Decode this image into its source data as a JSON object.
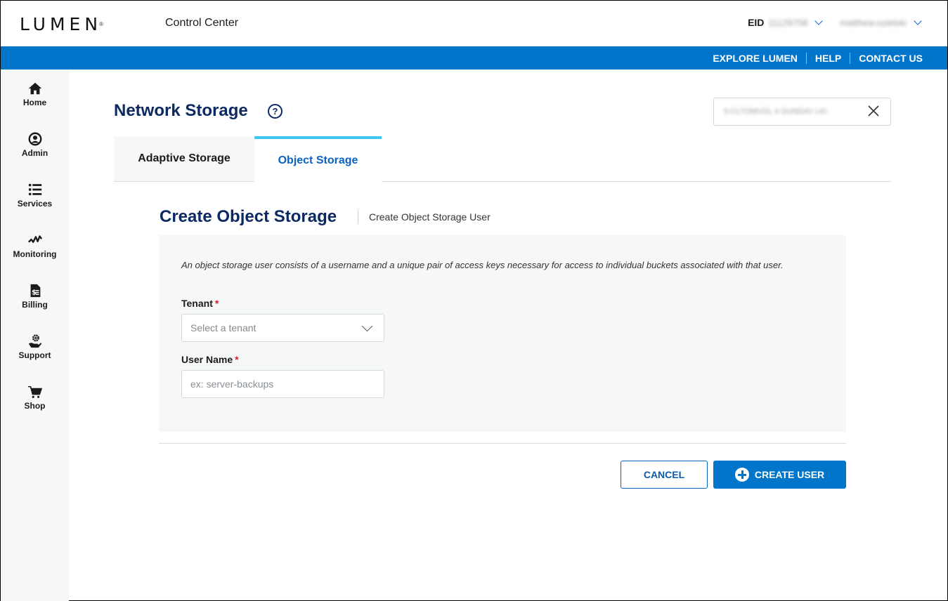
{
  "header": {
    "logo": "LUMEN",
    "app_title": "Control Center",
    "eid_label": "EID",
    "eid_value": "11129758",
    "username": "matthew.ozielski"
  },
  "utility_nav": [
    {
      "label": "EXPLORE LUMEN"
    },
    {
      "label": "HELP"
    },
    {
      "label": "CONTACT US"
    }
  ],
  "sidebar": {
    "items": [
      {
        "label": "Home",
        "icon": "home-icon"
      },
      {
        "label": "Admin",
        "icon": "user-circle-icon"
      },
      {
        "label": "Services",
        "icon": "list-icon"
      },
      {
        "label": "Monitoring",
        "icon": "pulse-icon"
      },
      {
        "label": "Billing",
        "icon": "invoice-icon"
      },
      {
        "label": "Support",
        "icon": "support-hand-gear-icon"
      },
      {
        "label": "Shop",
        "icon": "cart-icon"
      }
    ]
  },
  "page": {
    "title": "Network Storage",
    "account_chip": "5-CLTOMVGL 4 GUNDAY LKI"
  },
  "tabs": [
    {
      "label": "Adaptive Storage",
      "active": false
    },
    {
      "label": "Object Storage",
      "active": true
    }
  ],
  "section": {
    "title": "Create Object Storage",
    "subtitle": "Create Object Storage User"
  },
  "form": {
    "description": "An object storage user consists of a username and a unique pair of access keys necessary for access to individual buckets associated with that user.",
    "tenant": {
      "label": "Tenant",
      "required_marker": "*",
      "placeholder": "Select a tenant"
    },
    "username": {
      "label": "User Name",
      "required_marker": "*",
      "placeholder": "ex: server-backups",
      "value": ""
    }
  },
  "actions": {
    "cancel_label": "CANCEL",
    "create_label": "CREATE USER"
  },
  "colors": {
    "brand_blue": "#0075c9",
    "navy": "#0b2a63",
    "tab_accent": "#3ec6f0",
    "required": "#d41b2c"
  }
}
